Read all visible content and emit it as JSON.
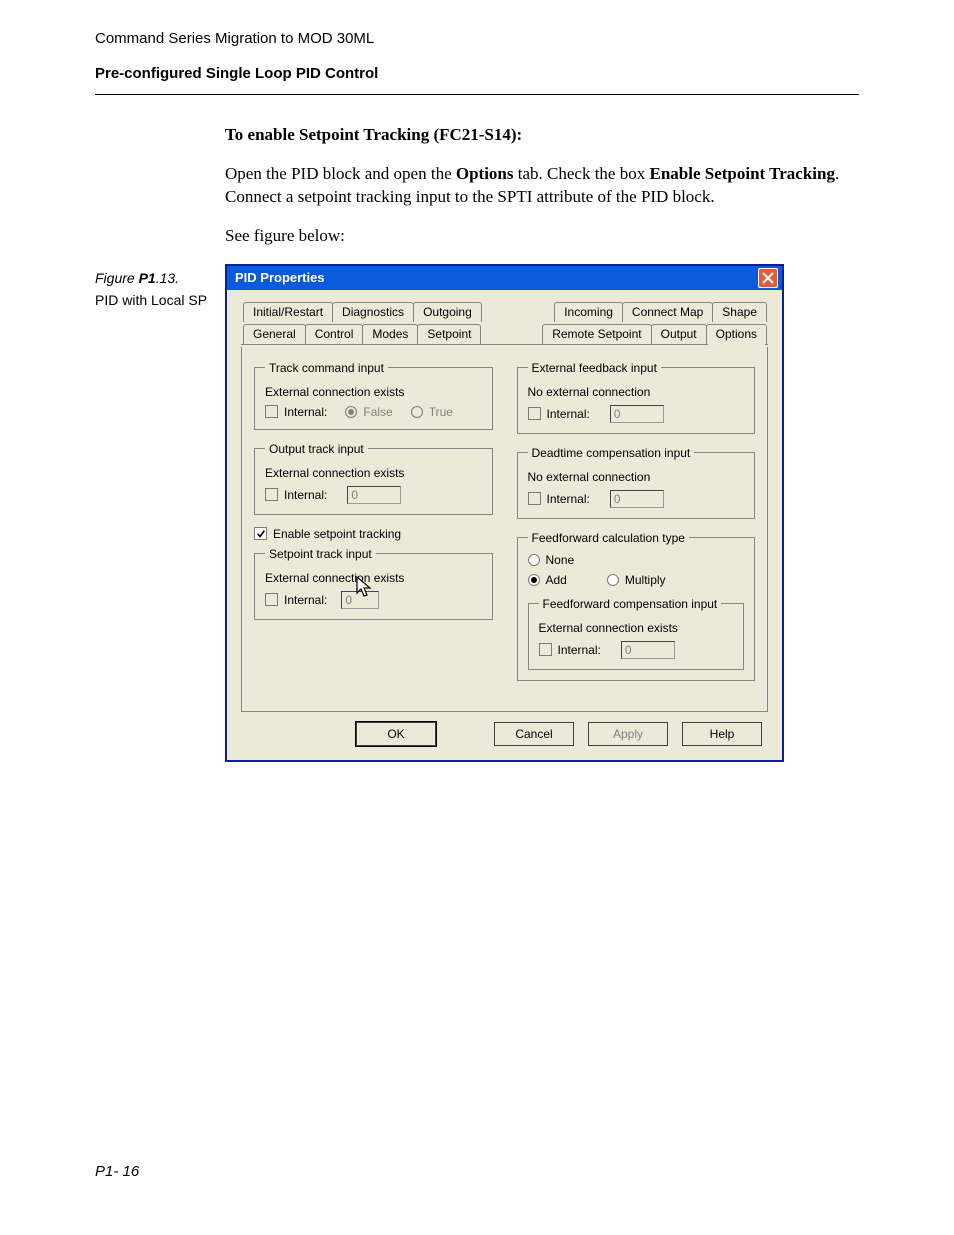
{
  "header": {
    "doc_title": "Command Series Migration to MOD 30ML",
    "section": "Pre-configured Single Loop PID Control"
  },
  "body": {
    "heading": "To enable Setpoint Tracking (FC21-S14):",
    "p1_a": "Open the PID block and open the ",
    "p1_b": "Options",
    "p1_c": " tab. Check the box ",
    "p1_d": "Enable Setpoint Tracking",
    "p1_e": ". Connect a setpoint tracking input to the SPTI attribute of the PID block.",
    "p2": "See figure below:"
  },
  "figure": {
    "label_a": "Figure ",
    "label_b": "P1",
    "label_c": ".13.",
    "caption": "PID with Local SP"
  },
  "dialog": {
    "title": "PID Properties",
    "tabs_row1": [
      "Initial/Restart",
      "Diagnostics",
      "Outgoing"
    ],
    "tabs_row1b": [
      "Incoming",
      "Connect Map",
      "Shape"
    ],
    "tabs_row2": [
      "General",
      "Control",
      "Modes",
      "Setpoint"
    ],
    "tabs_row2b": [
      "Remote Setpoint",
      "Output",
      "Options"
    ],
    "left": {
      "g1": {
        "legend": "Track command input",
        "status": "External connection exists",
        "internal": "Internal:",
        "false": "False",
        "true": "True"
      },
      "g2": {
        "legend": "Output track input",
        "status": "External connection exists",
        "internal": "Internal:",
        "value": "0"
      },
      "enable": "Enable setpoint tracking",
      "g3": {
        "legend": "Setpoint track input",
        "status": "External connection exists",
        "internal": "Internal:",
        "value": "0"
      }
    },
    "right": {
      "g1": {
        "legend": "External feedback input",
        "status": "No external connection",
        "internal": "Internal:",
        "value": "0"
      },
      "g2": {
        "legend": "Deadtime compensation input",
        "status": "No external connection",
        "internal": "Internal:",
        "value": "0"
      },
      "g3": {
        "legend": "Feedforward calculation type",
        "none": "None",
        "add": "Add",
        "mult": "Multiply"
      },
      "g4": {
        "legend": "Feedforward compensation input",
        "status": "External connection exists",
        "internal": "Internal:",
        "value": "0"
      }
    },
    "buttons": {
      "ok": "OK",
      "cancel": "Cancel",
      "apply": "Apply",
      "help": "Help"
    }
  },
  "footer": {
    "page": "P1- 16"
  }
}
